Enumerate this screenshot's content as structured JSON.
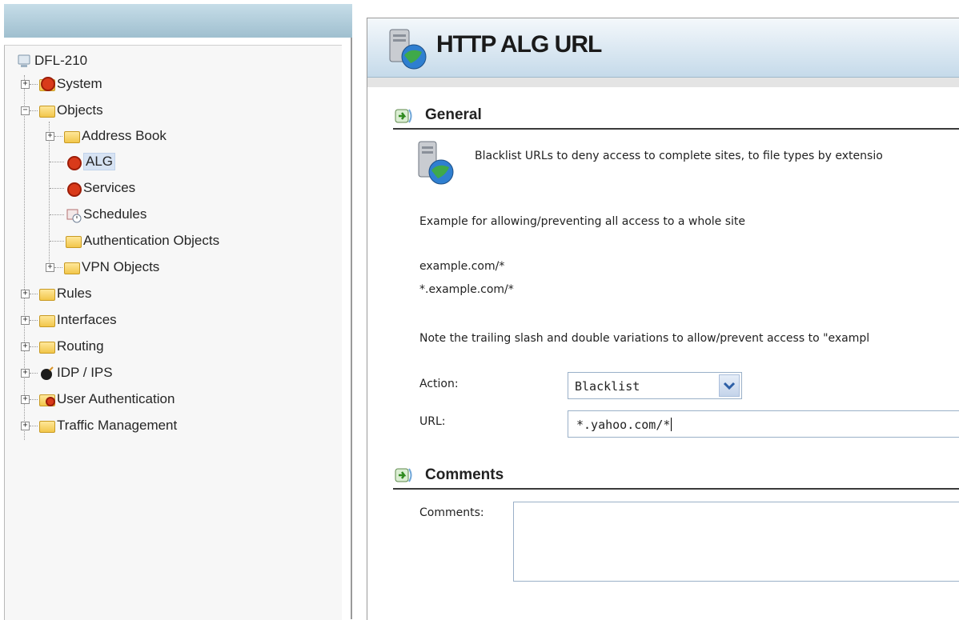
{
  "tree": {
    "root": "DFL-210",
    "system": "System",
    "objects": "Objects",
    "address_book": "Address Book",
    "alg": "ALG",
    "services": "Services",
    "schedules": "Schedules",
    "auth_objects": "Authentication Objects",
    "vpn_objects": "VPN Objects",
    "rules": "Rules",
    "interfaces": "Interfaces",
    "routing": "Routing",
    "idp_ips": "IDP / IPS",
    "user_auth": "User Authentication",
    "traffic_mgmt": "Traffic Management"
  },
  "page": {
    "title": "HTTP ALG URL"
  },
  "general": {
    "heading": "General",
    "description": "Blacklist URLs to deny access to complete sites, to file types by extensio",
    "example_intro": "Example for allowing/preventing all access to a whole site",
    "example_1": "example.com/*",
    "example_2": "*.example.com/*",
    "note": "Note the trailing slash and double variations to allow/prevent access to \"exampl",
    "action_label": "Action:",
    "action_value": "Blacklist",
    "url_label": "URL:",
    "url_value": "*.yahoo.com/*"
  },
  "comments": {
    "heading": "Comments",
    "label": "Comments:",
    "value": ""
  },
  "colors": {
    "title_bar_top": "#f4f8fb",
    "title_bar_bottom": "#c5daea",
    "selection": "#d7e3f3",
    "left_header": "#9fbfcf"
  }
}
